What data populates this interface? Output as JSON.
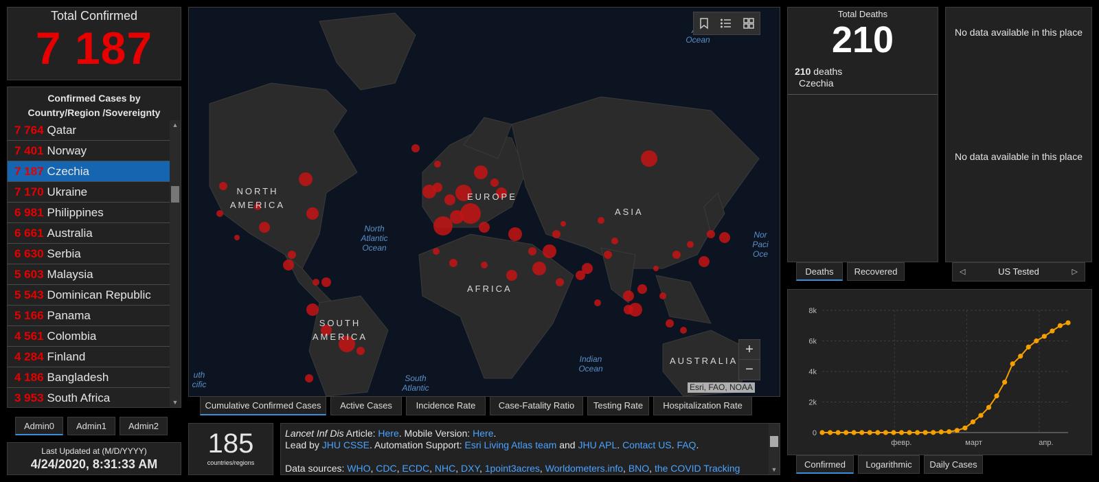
{
  "total_confirmed": {
    "title": "Total Confirmed",
    "value": "7 187"
  },
  "country_list": {
    "title": "Confirmed Cases by Country/Region /Sovereignty",
    "rows": [
      {
        "count": "7 764",
        "name": "Qatar"
      },
      {
        "count": "7 401",
        "name": "Norway"
      },
      {
        "count": "7 187",
        "name": "Czechia",
        "selected": true
      },
      {
        "count": "7 170",
        "name": "Ukraine"
      },
      {
        "count": "6 981",
        "name": "Philippines"
      },
      {
        "count": "6 661",
        "name": "Australia"
      },
      {
        "count": "6 630",
        "name": "Serbia"
      },
      {
        "count": "5 603",
        "name": "Malaysia"
      },
      {
        "count": "5 543",
        "name": "Dominican Republic"
      },
      {
        "count": "5 166",
        "name": "Panama"
      },
      {
        "count": "4 561",
        "name": "Colombia"
      },
      {
        "count": "4 284",
        "name": "Finland"
      },
      {
        "count": "4 186",
        "name": "Bangladesh"
      },
      {
        "count": "3 953",
        "name": "South Africa"
      }
    ],
    "admin_tabs": [
      "Admin0",
      "Admin1",
      "Admin2"
    ]
  },
  "last_updated": {
    "label": "Last Updated at (M/D/YYYY)",
    "value": "4/24/2020, 8:31:33 AM"
  },
  "map": {
    "labels": {
      "north_america": "NORTH AMERICA",
      "europe": "EUROPE",
      "asia": "ASIA",
      "africa": "AFRICA",
      "south_america": "SOUTH AMERICA",
      "australia": "AUSTRALIA"
    },
    "oceans": {
      "north_atlantic": "North Atlantic Ocean",
      "indian": "Indian Ocean",
      "south_atlantic": "South Atlantic",
      "arctic": "Arc Ocean",
      "north_pacific": "Nor Paci Oce",
      "south_pacific": "uth cific"
    },
    "attribution": "Esri, FAO, NOAA",
    "zoom_in": "+",
    "zoom_out": "−",
    "tabs": [
      "Cumulative Confirmed Cases",
      "Active Cases",
      "Incidence Rate",
      "Case-Fatality Ratio",
      "Testing Rate",
      "Hospitalization Rate"
    ]
  },
  "countries": {
    "count": "185",
    "label": "countries/regions"
  },
  "info": {
    "article_prefix": "Lancet Inf Dis",
    "article_word": " Article: ",
    "here1": "Here",
    "mobile": ". Mobile Version: ",
    "here2": "Here",
    "period": ".",
    "lead_by": "Lead by ",
    "jhu_csse": "JHU CSSE",
    "automation": ". Automation Support: ",
    "esri": "Esri Living Atlas team",
    "and": " and ",
    "jhu_apl": "JHU APL",
    "dot_sp": ". ",
    "contact": "Contact US",
    "dot_sp2": ". ",
    "faq": "FAQ",
    "dot_end": ".",
    "sources_label": "Data sources: ",
    "sources": [
      "WHO",
      "CDC",
      "ECDC",
      "NHC",
      "DXY",
      "1point3acres",
      "Worldometers.info",
      "BNO",
      "the COVID Tracking"
    ]
  },
  "total_deaths": {
    "title": "Total Deaths",
    "value": "210",
    "detail_count": "210",
    "detail_word": " deaths",
    "detail_place": "Czechia"
  },
  "death_tabs": [
    "Deaths",
    "Recovered"
  ],
  "no_data": {
    "msg1": "No data available in this place",
    "msg2": "No data available in this place"
  },
  "us_tested": {
    "label": "US Tested"
  },
  "chart_tabs": [
    "Confirmed",
    "Logarithmic",
    "Daily Cases"
  ],
  "colors": {
    "accent_red": "#e60000",
    "selected_blue": "#1565b0",
    "tab_underline": "#3a8fd9",
    "series": "#f5a000"
  },
  "chart_data": {
    "type": "line",
    "x_tick_labels": [
      "февр.",
      "март",
      "апр."
    ],
    "y_tick_labels": [
      "0",
      "2k",
      "4k",
      "6k",
      "8k"
    ],
    "ylim": [
      0,
      8000
    ],
    "grid": true,
    "series": [
      {
        "x": [
          "2020-01-22",
          "2020-01-25",
          "2020-01-28",
          "2020-01-31",
          "2020-02-03",
          "2020-02-06",
          "2020-02-09",
          "2020-02-12",
          "2020-02-15",
          "2020-02-18",
          "2020-02-21",
          "2020-02-24",
          "2020-02-27",
          "2020-03-01",
          "2020-03-04",
          "2020-03-07",
          "2020-03-10",
          "2020-03-13",
          "2020-03-16",
          "2020-03-19",
          "2020-03-22",
          "2020-03-25",
          "2020-03-28",
          "2020-03-31",
          "2020-04-03",
          "2020-04-06",
          "2020-04-09",
          "2020-04-12",
          "2020-04-15",
          "2020-04-18",
          "2020-04-21",
          "2020-04-24"
        ],
        "y": [
          0,
          0,
          0,
          0,
          0,
          0,
          0,
          0,
          0,
          0,
          0,
          0,
          0,
          3,
          5,
          40,
          60,
          140,
          300,
          700,
          1120,
          1650,
          2400,
          3300,
          4500,
          5000,
          5600,
          6000,
          6300,
          6650,
          7000,
          7187
        ]
      }
    ]
  }
}
